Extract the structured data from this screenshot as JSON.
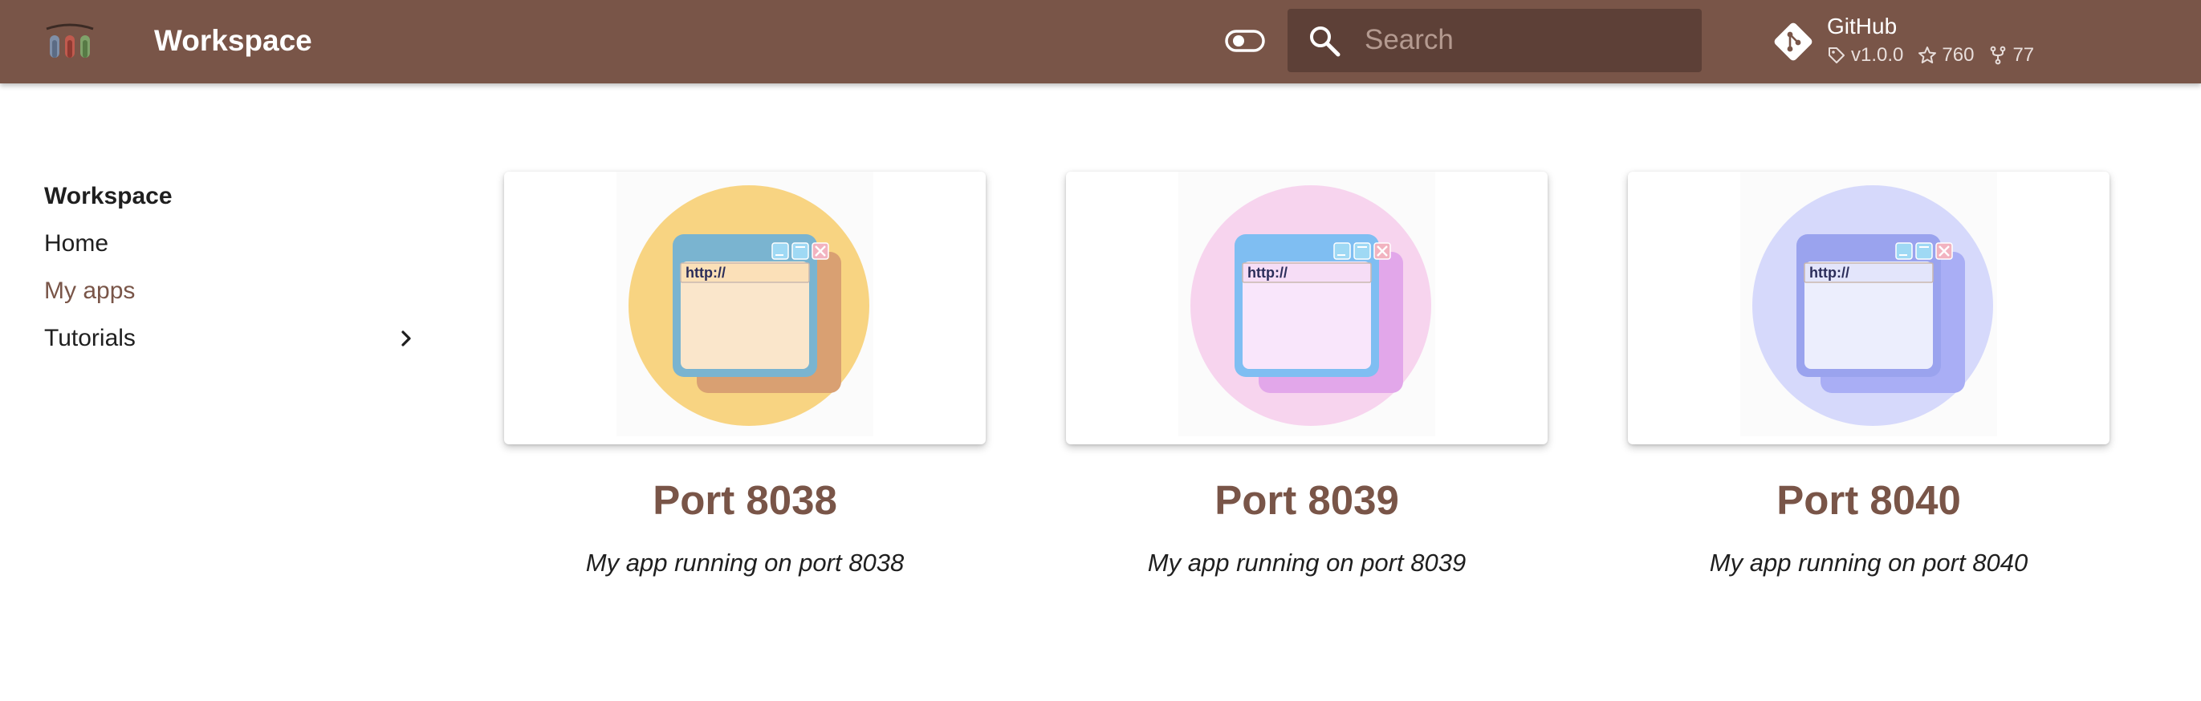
{
  "header": {
    "title": "Workspace",
    "search_placeholder": "Search",
    "repo": {
      "name": "GitHub",
      "version": "v1.0.0",
      "stars": "760",
      "forks": "77"
    }
  },
  "sidebar": {
    "title": "Workspace",
    "items": [
      {
        "label": "Home",
        "icon": ""
      },
      {
        "label": "My apps",
        "icon": ""
      },
      {
        "label": "Tutorials",
        "icon": "chevron-right-icon"
      }
    ]
  },
  "cards": [
    {
      "title": "Port 8038",
      "description": "My app running on port 8038",
      "url_text": "http://",
      "theme": {
        "circle": "#f8d482",
        "window": "#7ab4d0",
        "shadow": "#d9a072",
        "panel": "#fae6cb",
        "urlbar": "#fbe0b8"
      }
    },
    {
      "title": "Port 8039",
      "description": "My app running on port 8039",
      "url_text": "http://",
      "theme": {
        "circle": "#f7d4ee",
        "window": "#7fbef2",
        "shadow": "#e2a7ea",
        "panel": "#f9e6fb",
        "urlbar": "#f6ddf6"
      }
    },
    {
      "title": "Port 8040",
      "description": "My app running on port 8040",
      "url_text": "http://",
      "theme": {
        "circle": "#d6d9fb",
        "window": "#9aa3ee",
        "shadow": "#a9aef5",
        "panel": "#eceefd",
        "urlbar": "#e3e5fb"
      }
    }
  ],
  "colors": {
    "primary": "#795548",
    "primary_dark": "#5d4037",
    "text": "#1f1f1f"
  }
}
